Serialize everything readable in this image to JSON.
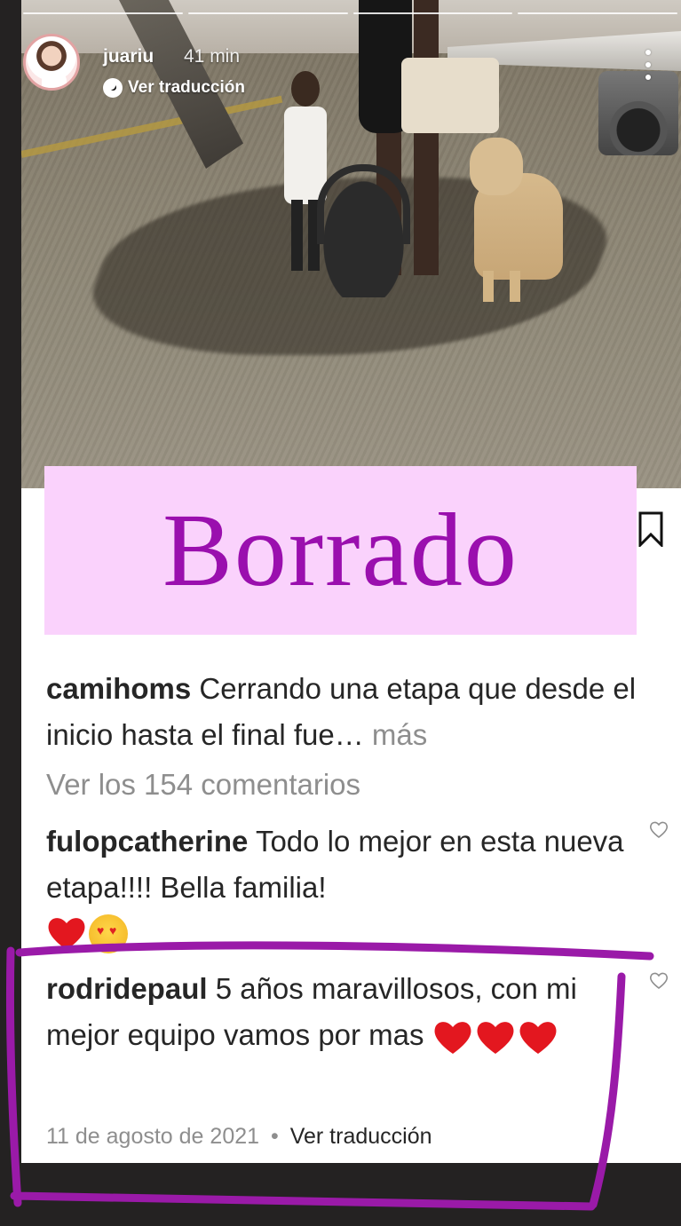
{
  "story": {
    "username": "juariu",
    "time_ago": "41 min",
    "translate_label": "Ver traducción",
    "progress_segments": 4
  },
  "banner": {
    "text": "Borrado",
    "background": "#fad2fc",
    "text_color": "#9a0fae"
  },
  "post": {
    "caption": {
      "user": "camihoms",
      "text": "Cerrando una etapa que desde el inicio hasta el final fue…",
      "more": "más"
    },
    "view_comments": "Ver los 154 comentarios",
    "comments": [
      {
        "user": "fulopcatherine",
        "text": "Todo lo mejor en esta nueva etapa!!!! Bella familia!",
        "emojis": [
          "red-heart",
          "smiling-face-with-heart-eyes"
        ]
      },
      {
        "user": "rodridepaul",
        "text": "5 años maravillosos, con mi mejor equipo vamos por mas",
        "emojis": [
          "red-heart",
          "red-heart",
          "red-heart"
        ],
        "date": "11 de agosto de 2021",
        "separator": "•",
        "translate": "Ver traducción"
      }
    ]
  },
  "colors": {
    "highlight": "#9a1aa8",
    "secondary_text": "#8e8e8e",
    "primary_text": "#262626"
  }
}
